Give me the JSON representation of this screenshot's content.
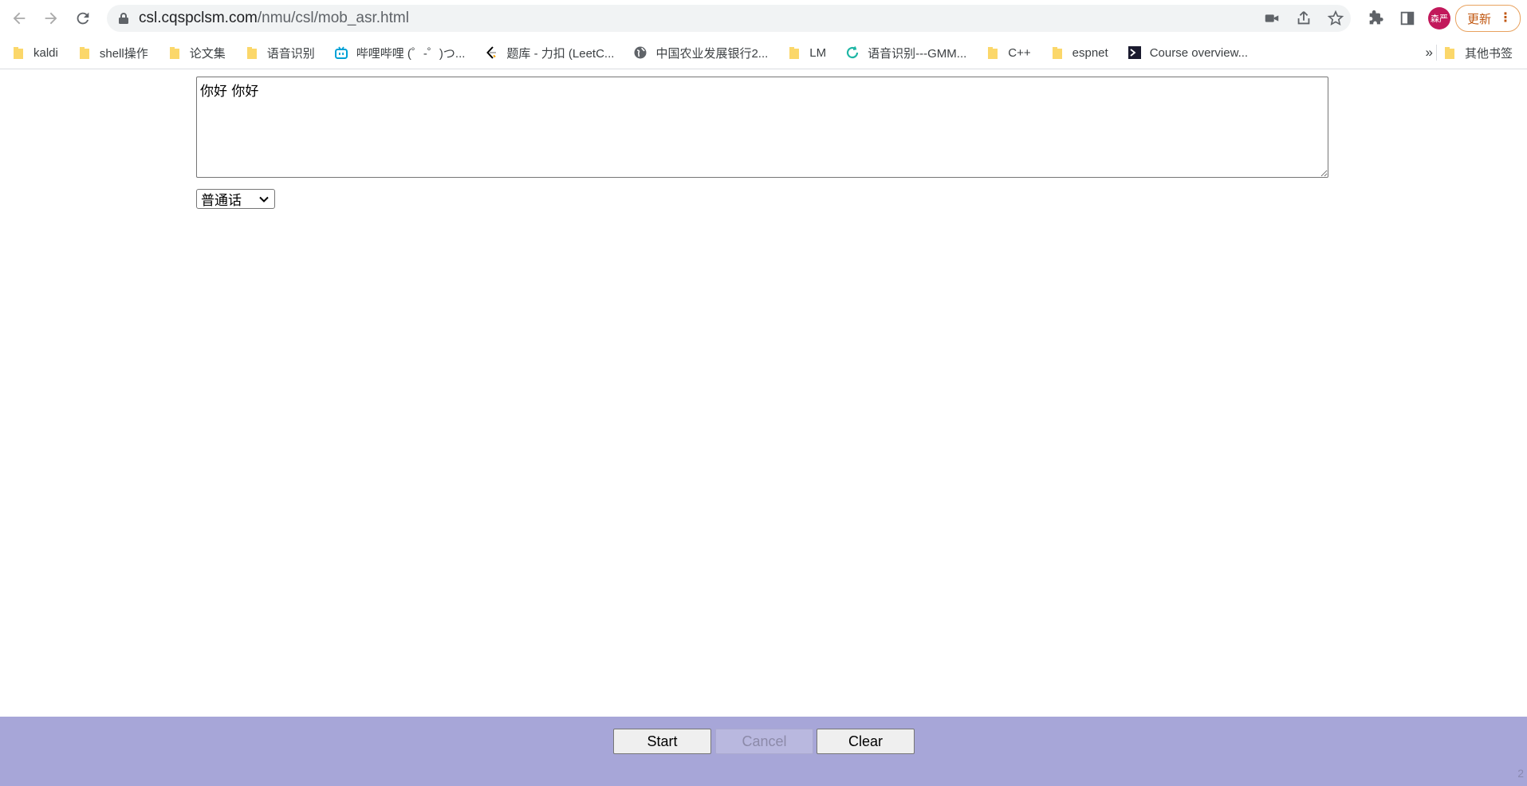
{
  "browser": {
    "url_host": "csl.cqspclsm.com",
    "url_path": "/nmu/csl/mob_asr.html",
    "profile_initials": "森严",
    "update_label": "更新",
    "more_label": "⋮"
  },
  "bookmarks": {
    "items": [
      {
        "label": "kaldi",
        "icon": "folder-icon"
      },
      {
        "label": "shell操作",
        "icon": "folder-icon"
      },
      {
        "label": "论文集",
        "icon": "folder-icon"
      },
      {
        "label": "语音识别",
        "icon": "folder-icon"
      },
      {
        "label": "哔哩哔哩 (゜-゜)つ...",
        "icon": "bilibili-icon"
      },
      {
        "label": "题库 - 力扣 (LeetC...",
        "icon": "leetcode-icon"
      },
      {
        "label": "中国农业发展银行2...",
        "icon": "globe-icon"
      },
      {
        "label": "LM",
        "icon": "folder-icon"
      },
      {
        "label": "语音识别---GMM...",
        "icon": "refresh-spinner-icon"
      },
      {
        "label": "C++",
        "icon": "folder-icon"
      },
      {
        "label": "espnet",
        "icon": "folder-icon"
      },
      {
        "label": "Course overview...",
        "icon": "terminal-icon"
      }
    ],
    "overflow_label": "»",
    "other_label": "其他书签"
  },
  "page": {
    "result_text": "你好 你好",
    "language": "普通话",
    "buttons": {
      "start": "Start",
      "cancel": "Cancel",
      "clear": "Clear"
    },
    "page_number": "2"
  },
  "colors": {
    "footer_bg": "#a7a6d8",
    "accent_update": "#c0560f"
  }
}
